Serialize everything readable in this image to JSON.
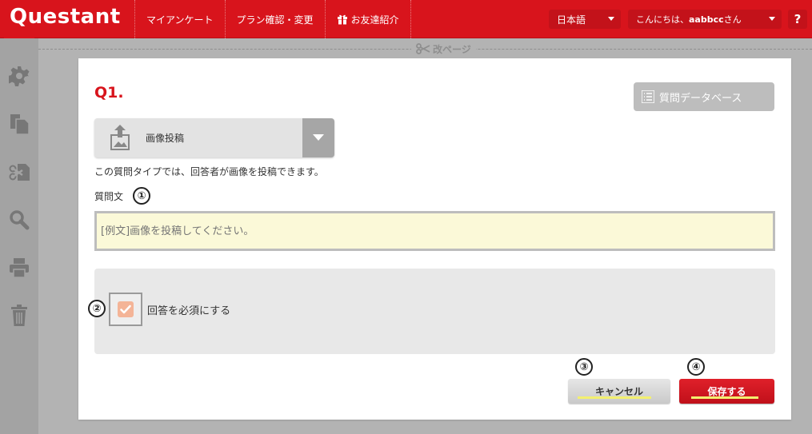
{
  "header": {
    "logo": "Questant",
    "nav": [
      {
        "label": "マイアンケート"
      },
      {
        "label": "プラン確認・変更"
      },
      {
        "label": "お友達紹介"
      }
    ],
    "language": "日本語",
    "greeting_prefix": "こんにちは、",
    "username": "aabbcc",
    "greeting_suffix": "さん",
    "help": "?"
  },
  "pagebreak": {
    "label": "改ページ"
  },
  "question": {
    "number": "Q1.",
    "database_button": "質問データベース",
    "type_label": "画像投稿",
    "type_description": "この質問タイプでは、回答者が画像を投稿できます。",
    "text_label": "質問文",
    "text_placeholder": "[例文]画像を投稿してください。",
    "required_label": "回答を必須にする",
    "cancel_button": "キャンセル",
    "save_button": "保存する"
  },
  "badges": [
    "①",
    "②",
    "③",
    "④"
  ],
  "colors": {
    "brand_red": "#d8141c",
    "input_bg": "#fbf9d8",
    "checkbox_fill": "#f4b497"
  },
  "sidebar_icons": [
    "gear-icon",
    "copy-icon",
    "cut-icon",
    "search-icon",
    "print-icon",
    "trash-icon"
  ]
}
